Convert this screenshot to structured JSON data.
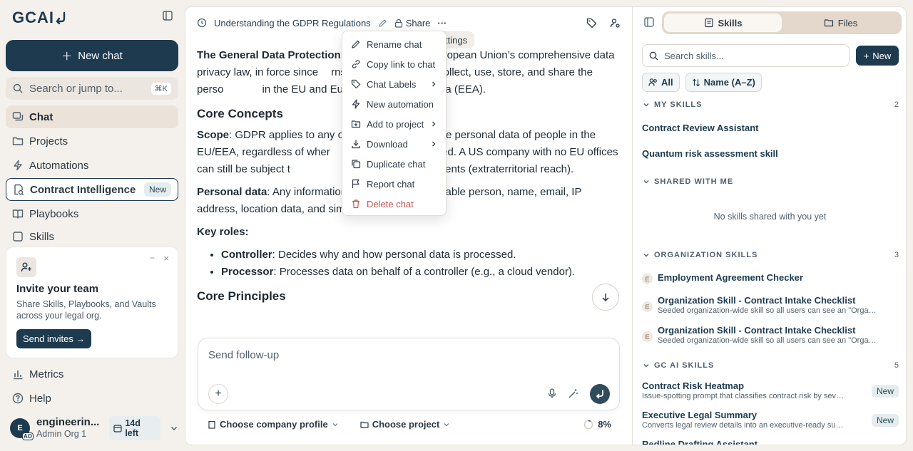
{
  "sidebar": {
    "logo": "GCAI",
    "new_chat": "New chat",
    "search": {
      "placeholder": "Search or jump to...",
      "shortcut": "⌘K"
    },
    "nav": {
      "chat": "Chat",
      "projects": "Projects",
      "automations": "Automations",
      "contract_intelligence": "Contract Intelligence",
      "contract_intelligence_badge": "New",
      "playbooks": "Playbooks",
      "skills": "Skills",
      "metrics": "Metrics",
      "help": "Help"
    },
    "invite": {
      "title": "Invite your team",
      "body": "Share Skills, Playbooks, and Vaults across your legal org.",
      "button": "Send invites →",
      "minimize": "−",
      "close": "×"
    },
    "user": {
      "avatar": "E",
      "avatar_sub": "AO",
      "name": "engineerin...",
      "org": "Admin Org 1",
      "days_left": "14d left"
    }
  },
  "topbar": {
    "title": "Understanding the GDPR Regulations",
    "share": "Share",
    "more": "···"
  },
  "doc": {
    "intro_bold": "The General Data Protection R",
    "intro_rest": "e European Union’s comprehensive data privacy law, in force since",
    "intro_rest2": "rns how organizations collect, use, store, and share the perso",
    "intro_rest3": "in the EU and European Economic Area (EEA).",
    "h_core_concepts": "Core Concepts",
    "scope_label": "Scope",
    "scope_text": ": GDPR applies to any or",
    "scope_text2": "ses the personal data of people in the EU/EEA, regardless of wher",
    "scope_text3": "lf is located. A US company with no EU offices can still be subject t",
    "scope_text4": "monitors EU residents (extraterritorial reach).",
    "pd_label": "Personal data",
    "pd_text": ": Any information relating to an identifiable person, name, email, IP address, location data, and similar identifiers.",
    "key_roles": "Key roles:",
    "controller_label": "Controller",
    "controller_text": ": Decides why and how personal data is processed.",
    "processor_label": "Processor",
    "processor_text": ": Processes data on behalf of a controller (e.g., a cloud vendor).",
    "h_core_principles": "Core Principles"
  },
  "composer": {
    "placeholder": "Send follow-up",
    "company_profile": "Choose company profile",
    "project": "Choose project",
    "progress_label": "8%",
    "progress": 0.08
  },
  "menu": {
    "settings_pill": "ttings",
    "items": [
      {
        "label": "Rename chat",
        "icon": "pencil-icon"
      },
      {
        "label": "Copy link to chat",
        "icon": "link-icon"
      },
      {
        "label": "Chat Labels",
        "icon": "tag-icon",
        "submenu": true
      },
      {
        "label": "New automation",
        "icon": "bolt-icon"
      },
      {
        "label": "Add to project",
        "icon": "folder-plus-icon",
        "submenu": true
      },
      {
        "label": "Download",
        "icon": "download-icon",
        "submenu": true
      },
      {
        "label": "Duplicate chat",
        "icon": "copy-icon"
      },
      {
        "label": "Report chat",
        "icon": "flag-icon"
      },
      {
        "label": "Delete chat",
        "icon": "trash-icon",
        "danger": true
      }
    ]
  },
  "rpanel": {
    "tabs": {
      "skills": "Skills",
      "files": "Files"
    },
    "search_placeholder": "Search skills...",
    "new_button": "New",
    "filter_all": "All",
    "filter_sort": "Name (A–Z)",
    "my_skills": {
      "title": "MY SKILLS",
      "count": "2",
      "items": [
        "Contract Review Assistant",
        "Quantum risk assessment skill"
      ]
    },
    "shared": {
      "title": "SHARED WITH ME",
      "empty": "No skills shared with you yet"
    },
    "org_skills": {
      "title": "ORGANIZATION SKILLS",
      "count": "3",
      "items": [
        {
          "icon": "E",
          "title": "Employment Agreement Checker",
          "desc": ""
        },
        {
          "icon": "E",
          "title": "Organization Skill - Contract Intake Checklist",
          "desc": "Seeded organization-wide skill so all users can see an \"Organi..."
        },
        {
          "icon": "E",
          "title": "Organization Skill - Contract Intake Checklist",
          "desc": "Seeded organization-wide skill so all users can see an \"Organi..."
        }
      ]
    },
    "gc_skills": {
      "title": "GC AI SKILLS",
      "count": "5",
      "items": [
        {
          "title": "Contract Risk Heatmap",
          "desc": "Issue-spotting prompt that classifies contract risk by seve...",
          "badge": "New"
        },
        {
          "title": "Executive Legal Summary",
          "desc": "Converts legal review details into an executive-ready sum...",
          "badge": "New"
        },
        {
          "title": "Redline Drafting Assistant",
          "desc": "",
          "badge": ""
        }
      ]
    }
  }
}
